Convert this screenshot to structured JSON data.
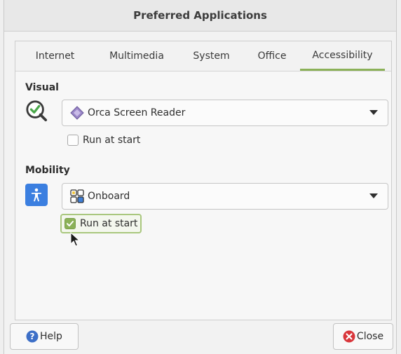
{
  "window": {
    "title": "Preferred Applications"
  },
  "tabs": [
    {
      "label": "Internet"
    },
    {
      "label": "Multimedia"
    },
    {
      "label": "System"
    },
    {
      "label": "Office"
    },
    {
      "label": "Accessibility",
      "active": true
    }
  ],
  "visual": {
    "heading": "Visual",
    "app_icon": "magnifier-check-icon",
    "selected": "Orca Screen Reader",
    "selected_icon": "orca-icon",
    "run_at_start_label": "Run at start",
    "run_at_start_checked": false
  },
  "mobility": {
    "heading": "Mobility",
    "app_icon": "accessibility-person-icon",
    "selected": "Onboard",
    "selected_icon": "onboard-keyboard-icon",
    "run_at_start_label": "Run at start",
    "run_at_start_checked": true
  },
  "buttons": {
    "help": "Help",
    "close": "Close"
  },
  "colors": {
    "accent": "#8bb158",
    "help_blue": "#3d6fc7",
    "close_red": "#d9363b",
    "access_blue": "#3b7fe0"
  }
}
